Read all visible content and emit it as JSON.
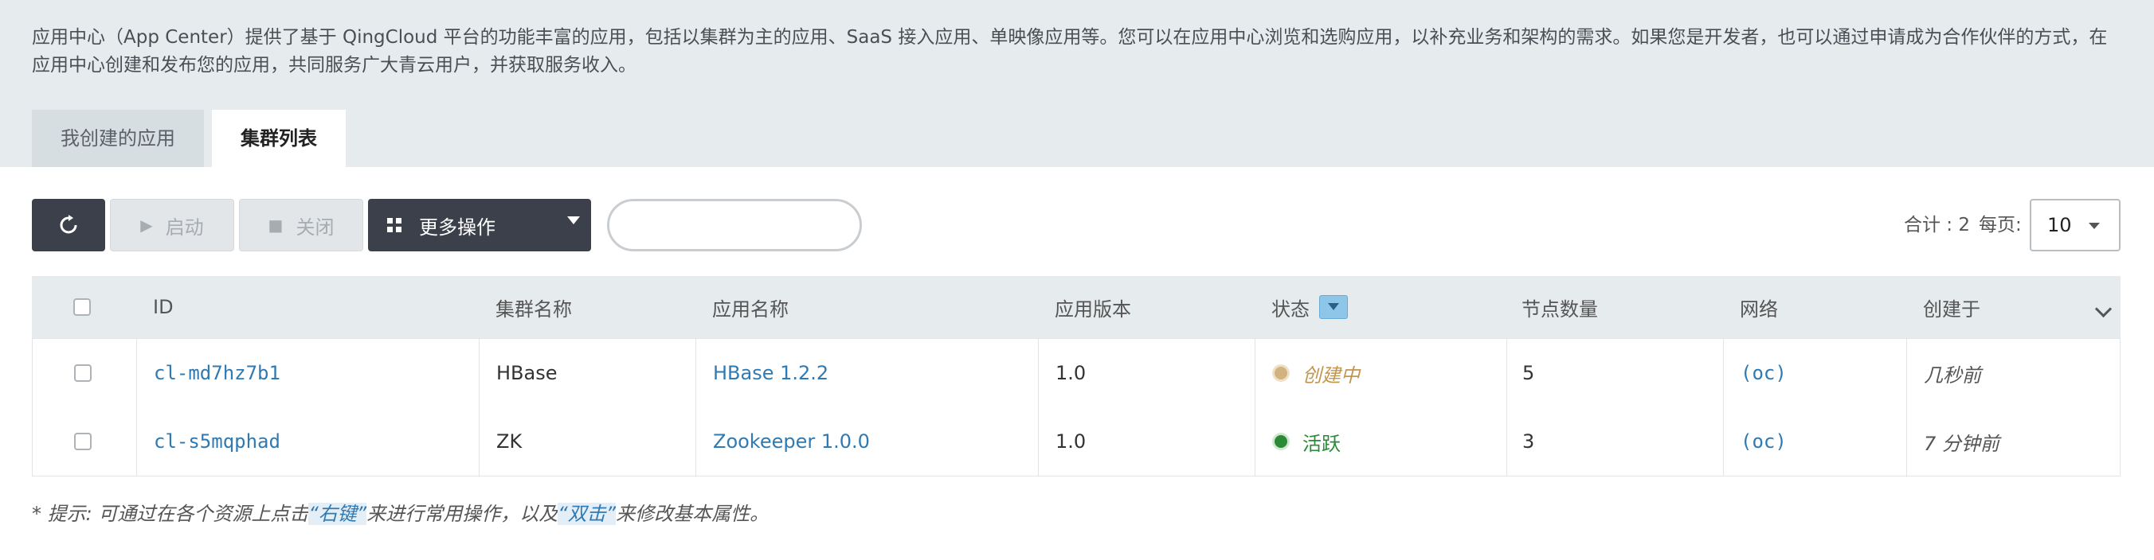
{
  "description": "应用中心（App Center）提供了基于 QingCloud 平台的功能丰富的应用，包括以集群为主的应用、SaaS 接入应用、单映像应用等。您可以在应用中心浏览和选购应用，以补充业务和架构的需求。如果您是开发者，也可以通过申请成为合作伙伴的方式，在应用中心创建和发布您的应用，共同服务广大青云用户，并获取服务收入。",
  "tabs": [
    {
      "label": "我创建的应用",
      "active": false
    },
    {
      "label": "集群列表",
      "active": true
    }
  ],
  "toolbar": {
    "refresh_icon": "refresh-icon",
    "start_label": "启动",
    "close_label": "关闭",
    "more_label": "更多操作",
    "search_placeholder": ""
  },
  "pagination": {
    "total_text": "合计 : 2",
    "per_page_label": "每页:",
    "page_size": "10"
  },
  "table": {
    "columns": [
      "ID",
      "集群名称",
      "应用名称",
      "应用版本",
      "状态",
      "节点数量",
      "网络",
      "创建于"
    ],
    "rows": [
      {
        "id": "cl-md7hz7b1",
        "cluster_name": "HBase",
        "app_name": "HBase 1.2.2",
        "version": "1.0",
        "status": "创建中",
        "nodes": "5",
        "network": "(oc)",
        "created": "几秒前"
      },
      {
        "id": "cl-s5mqphad",
        "cluster_name": "ZK",
        "app_name": "Zookeeper 1.0.0",
        "version": "1.0",
        "status": "活跃",
        "nodes": "3",
        "network": "(oc)",
        "created": "7 分钟前"
      }
    ]
  },
  "hint": {
    "prefix": "* 提示:  可通过在各个资源上点击",
    "right_click": "“右键”",
    "middle": "来进行常用操作，以及",
    "double_click": "“双击”",
    "suffix": "来修改基本属性。"
  },
  "colors": {
    "banner_bg": "#e6ebee",
    "dark_button": "#3b404a",
    "link": "#2f7ab3",
    "status_creating": "#c2964e",
    "status_active": "#2a8a36"
  }
}
